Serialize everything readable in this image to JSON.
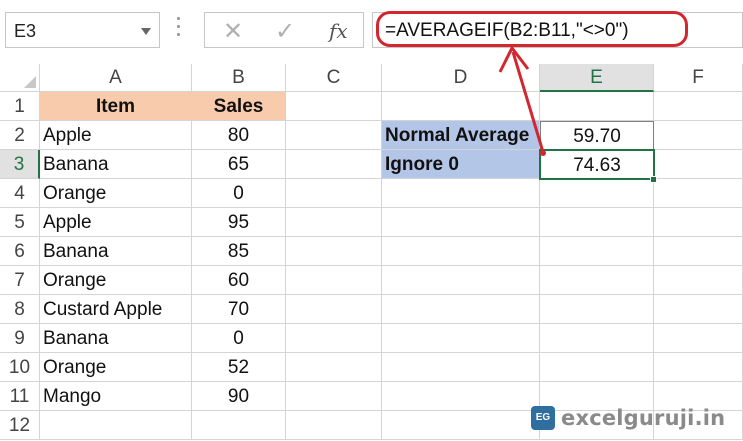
{
  "formula_bar": {
    "name_box": "E3",
    "cancel_icon": "✕",
    "enter_icon": "✓",
    "fx_label": "fx",
    "formula": "=AVERAGEIF(B2:B11,\"<>0\")"
  },
  "columns": [
    "A",
    "B",
    "C",
    "D",
    "E",
    "F"
  ],
  "active_column": "E",
  "rows": [
    "1",
    "2",
    "3",
    "4",
    "5",
    "6",
    "7",
    "8",
    "9",
    "10",
    "11",
    "12"
  ],
  "active_row": "3",
  "table": {
    "headers": [
      "Item",
      "Sales"
    ],
    "rows": [
      [
        "Apple",
        "80"
      ],
      [
        "Banana",
        "65"
      ],
      [
        "Orange",
        "0"
      ],
      [
        "Apple",
        "95"
      ],
      [
        "Banana",
        "85"
      ],
      [
        "Orange",
        "60"
      ],
      [
        "Custard Apple",
        "70"
      ],
      [
        "Banana",
        "0"
      ],
      [
        "Orange",
        "52"
      ],
      [
        "Mango",
        "90"
      ]
    ]
  },
  "summary": {
    "normal_label": "Normal Average",
    "normal_value": "59.70",
    "ignore_label": "Ignore 0",
    "ignore_value": "74.63"
  },
  "colors": {
    "header_fill": "#f8cbad",
    "label_fill": "#b4c6e7",
    "selection": "#217346",
    "annotation": "#d3262f"
  },
  "watermark": {
    "logo_text": "EG",
    "text": "excelguruji.in"
  }
}
